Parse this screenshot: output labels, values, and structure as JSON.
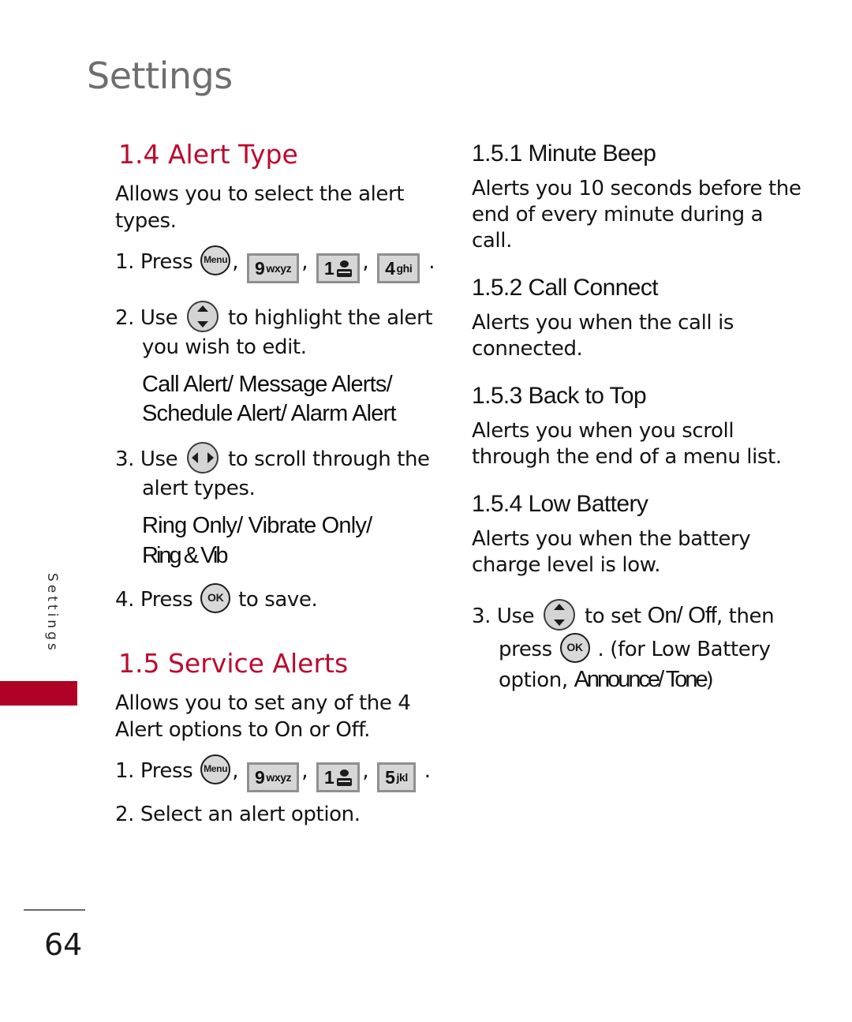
{
  "page": {
    "chapter_title": "Settings",
    "side_tab_label": "Settings",
    "page_number": "64"
  },
  "left_column": {
    "section_14": {
      "heading": "1.4 Alert Type",
      "intro": "Allows you to select the alert types.",
      "step1_prefix": "1. Press",
      "step1_keys": [
        {
          "type": "circle",
          "label": "Menu",
          "name": "menu-key"
        },
        {
          "type": "box",
          "num": "9",
          "sub": "wxyz",
          "name": "key-9"
        },
        {
          "type": "box",
          "num": "1",
          "sub": "voicemail",
          "name": "key-1"
        },
        {
          "type": "box",
          "num": "4",
          "sub": "ghi",
          "name": "key-4"
        }
      ],
      "step1_suffix": ".",
      "step2_prefix": "2. Use",
      "step2_key": "nav-up-down",
      "step2_suffix": "to highlight the alert",
      "step2_cont": "you wish to edit.",
      "step2_options_line1": "Call Alert/ Message Alerts/",
      "step2_options_line2": "Schedule Alert/ Alarm Alert",
      "step3_prefix": "3. Use",
      "step3_key": "nav-left-right",
      "step3_suffix": "to scroll through the",
      "step3_cont": "alert types.",
      "step3_options_line1": "Ring Only/ Vibrate Only/",
      "step3_options_line2": "Ring & Vib",
      "step4_prefix": "4. Press",
      "step4_key": "OK",
      "step4_suffix": "to save."
    },
    "section_15": {
      "heading": "1.5 Service Alerts",
      "intro": "Allows you to set any of the 4 Alert options to On or Off.",
      "step1_prefix": "1. Press",
      "step1_keys": [
        {
          "type": "circle",
          "label": "Menu",
          "name": "menu-key"
        },
        {
          "type": "box",
          "num": "9",
          "sub": "wxyz",
          "name": "key-9"
        },
        {
          "type": "box",
          "num": "1",
          "sub": "voicemail",
          "name": "key-1"
        },
        {
          "type": "box",
          "num": "5",
          "sub": "jkl",
          "name": "key-5"
        }
      ],
      "step1_suffix": ".",
      "step2": "2. Select an alert option."
    }
  },
  "right_column": {
    "sub_151": {
      "heading": "1.5.1 Minute Beep",
      "body": "Alerts you 10 seconds before the end of every minute during a call."
    },
    "sub_152": {
      "heading": "1.5.2 Call Connect",
      "body": "Alerts you when the call is connected."
    },
    "sub_153": {
      "heading": "1.5.3 Back to Top",
      "body": "Alerts you when you scroll through the end of a menu list."
    },
    "sub_154": {
      "heading": "1.5.4 Low Battery",
      "body": "Alerts you when the battery charge level is low."
    },
    "step3": {
      "prefix": "3. Use",
      "key": "nav-up-down",
      "mid": "to set",
      "options1": "On/ Off",
      "after_options": ", then",
      "cont_prefix": "press",
      "cont_key": "OK",
      "cont_suffix": ". (for Low Battery",
      "cont2_prefix": "option,",
      "options2": "Announce/ Tone",
      "cont2_suffix": ")"
    }
  },
  "colors": {
    "accent_crimson": "#bd0a2f",
    "side_bar": "#b00226",
    "title_gray": "#6e6e6e",
    "body_black": "#131313",
    "key_face": "#d6d6d6",
    "key_border": "#8f8f8f"
  }
}
